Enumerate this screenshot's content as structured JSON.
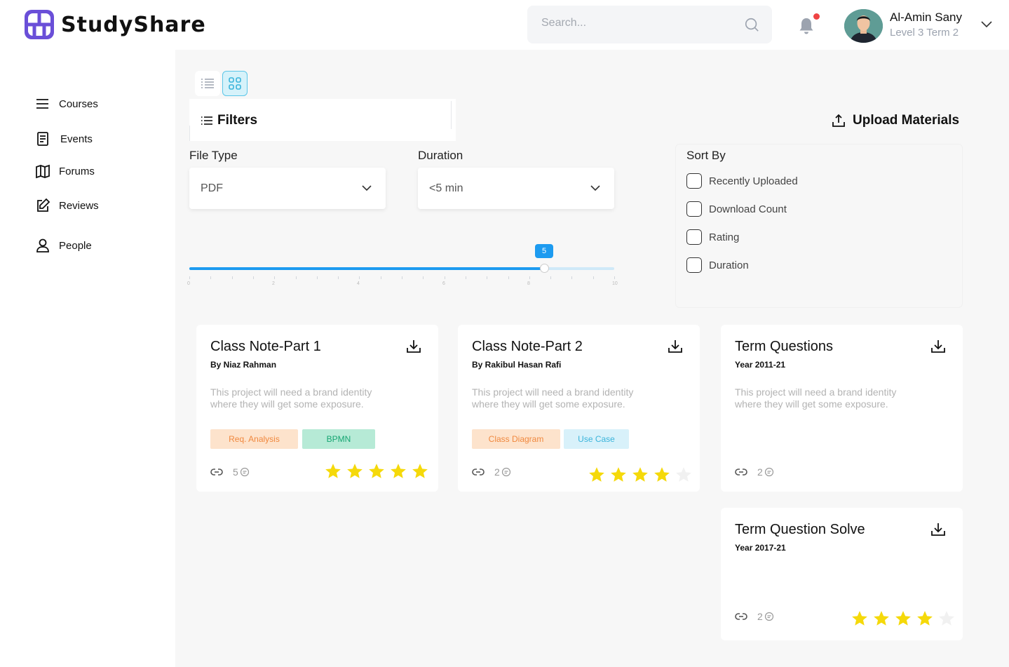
{
  "app": {
    "name": "StudyShare"
  },
  "search": {
    "placeholder": "Search..."
  },
  "user": {
    "name": "Al-Amin Sany",
    "level": "Level 3 Term 2"
  },
  "sidebar": {
    "items": [
      {
        "label": "Courses",
        "icon": "menu-icon"
      },
      {
        "label": "Events",
        "icon": "document-icon"
      },
      {
        "label": "Forums",
        "icon": "map-icon"
      },
      {
        "label": "Reviews",
        "icon": "edit-icon"
      },
      {
        "label": "People",
        "icon": "person-icon"
      }
    ]
  },
  "toolbar": {
    "filters_label": "Filters",
    "upload_label": "Upload Materials",
    "active_view": "grid"
  },
  "filters": {
    "file_type_label": "File Type",
    "file_type_value": "PDF",
    "duration_label": "Duration",
    "duration_value": "<5 min",
    "slider": {
      "value": 5,
      "min": 0,
      "max": 10,
      "fill_fraction": 0.835,
      "tick_labels": [
        "0",
        "2",
        "4",
        "6",
        "8",
        "10"
      ]
    }
  },
  "sort": {
    "label": "Sort By",
    "options": [
      "Recently Uploaded",
      "Download Count",
      "Rating",
      "Duration"
    ]
  },
  "cards": [
    {
      "title": "Class Note-Part 1",
      "subtitle": "By Niaz Rahman",
      "description": "This project will need a brand identity where they will get some exposure.",
      "tags": [
        {
          "label": "Req. Analysis",
          "style": "orange"
        },
        {
          "label": "BPMN",
          "style": "green"
        }
      ],
      "count": "5",
      "rating": 5
    },
    {
      "title": "Class Note-Part 2",
      "subtitle": "By Rakibul Hasan Rafi",
      "description": "This project will need a brand identity where they will get some exposure.",
      "tags": [
        {
          "label": "Class Diagram",
          "style": "orange"
        },
        {
          "label": "Use Case",
          "style": "blue"
        }
      ],
      "count": "2",
      "rating": 4
    },
    {
      "title": "Term Questions",
      "subtitle": "Year 2011-21",
      "description": "This project will need a brand identity where they will get some exposure.",
      "tags": [],
      "count": "2",
      "rating": null
    },
    {
      "title": "Term Question Solve",
      "subtitle": "Year 2017-21",
      "description": "",
      "tags": [],
      "count": "2",
      "rating": 4
    }
  ],
  "colors": {
    "brand": "#6a4fd8",
    "accent": "#1d9bf0",
    "star": "#f5d90a",
    "notification": "#ef4444"
  }
}
